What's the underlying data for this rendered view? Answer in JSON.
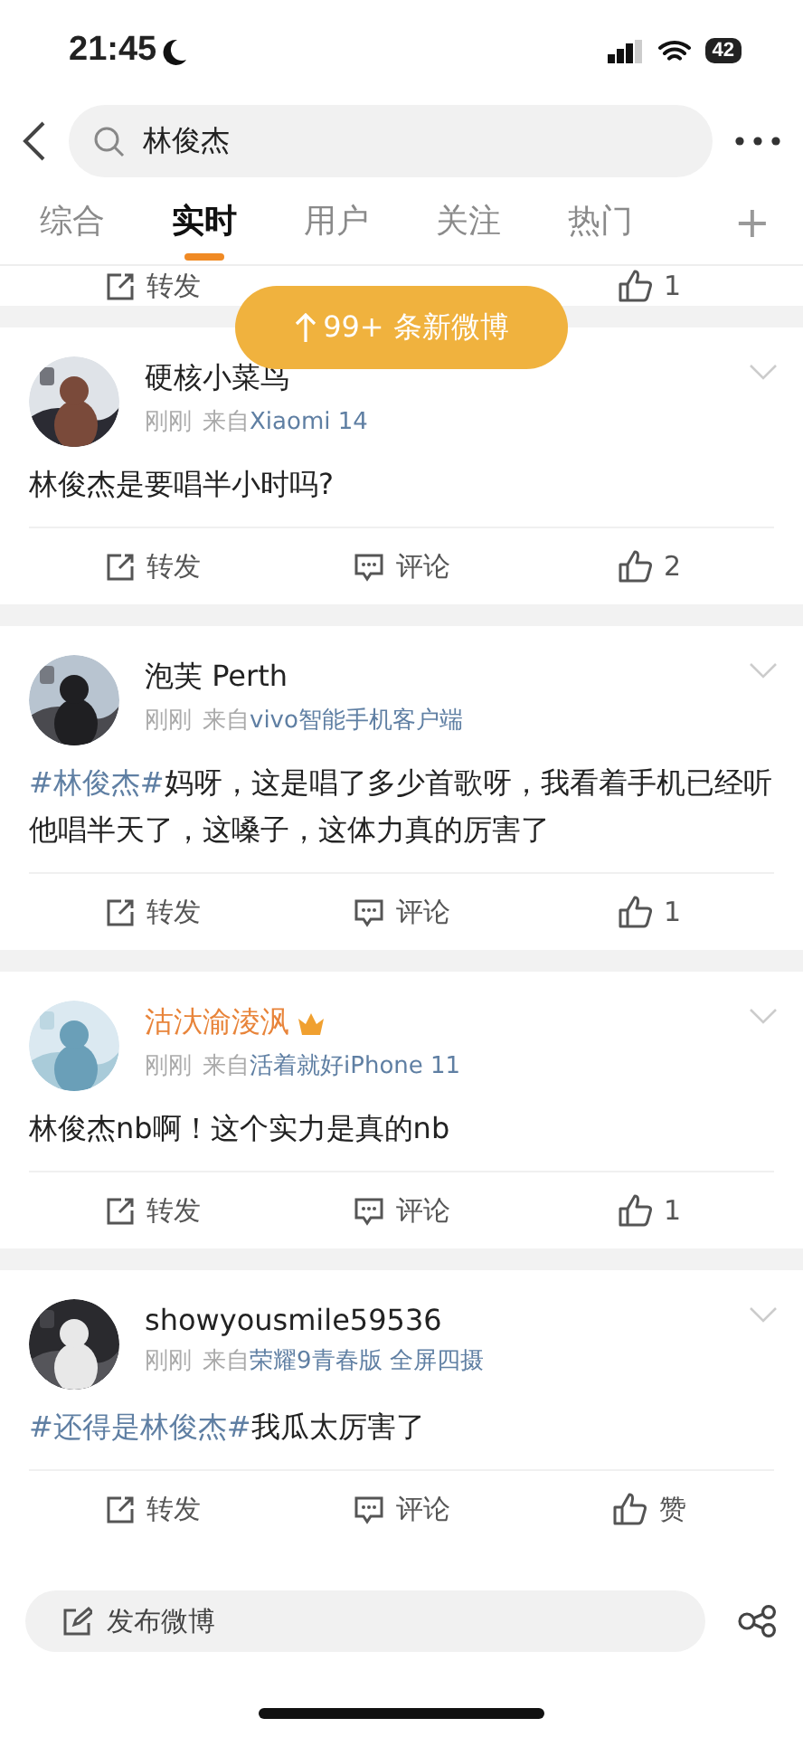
{
  "status_bar": {
    "time": "21:45",
    "battery": "42"
  },
  "search": {
    "value": "林俊杰"
  },
  "tabs": [
    {
      "label": "综合",
      "selected": false
    },
    {
      "label": "实时",
      "selected": true
    },
    {
      "label": "用户",
      "selected": false
    },
    {
      "label": "关注",
      "selected": false
    },
    {
      "label": "热门",
      "selected": false
    }
  ],
  "tab_add": "+",
  "new_posts_banner": "99+ 条新微博",
  "previous_post_actions": {
    "repost": "转发",
    "like": "1"
  },
  "posts": [
    {
      "user": {
        "name": "硬核小菜鸟",
        "vip": false
      },
      "time": "刚刚",
      "source_prefix": "来自",
      "source": "Xiaomi 14",
      "content": [
        {
          "kind": "text",
          "text": "林俊杰是要唱半小时吗?"
        }
      ],
      "actions": {
        "repost": "转发",
        "comment": "评论",
        "like": "2"
      }
    },
    {
      "user": {
        "name": "泡芙 Perth",
        "vip": false
      },
      "time": "刚刚",
      "source_prefix": "来自",
      "source": "vivo智能手机客户端",
      "content": [
        {
          "kind": "topic",
          "text": "#林俊杰#"
        },
        {
          "kind": "text",
          "text": "妈呀，这是唱了多少首歌呀，我看着手机已经听他唱半天了，这嗓子，这体力真的厉害了"
        }
      ],
      "actions": {
        "repost": "转发",
        "comment": "评论",
        "like": "1"
      }
    },
    {
      "user": {
        "name": "沽汏渝淩沨",
        "vip": true
      },
      "time": "刚刚",
      "source_prefix": "来自",
      "source": "活着就好iPhone 11",
      "content": [
        {
          "kind": "text",
          "text": "林俊杰nb啊！这个实力是真的nb"
        }
      ],
      "actions": {
        "repost": "转发",
        "comment": "评论",
        "like": "1"
      }
    },
    {
      "user": {
        "name": "showyousmile59536",
        "vip": false
      },
      "time": "刚刚",
      "source_prefix": "来自",
      "source": "荣耀9青春版 全屏四摄",
      "content": [
        {
          "kind": "topic",
          "text": "#还得是林俊杰#"
        },
        {
          "kind": "text",
          "text": "我瓜太厉害了"
        }
      ],
      "actions": {
        "repost": "转发",
        "comment": "评论",
        "like": "赞"
      }
    }
  ],
  "composer": {
    "placeholder": "发布微博"
  }
}
